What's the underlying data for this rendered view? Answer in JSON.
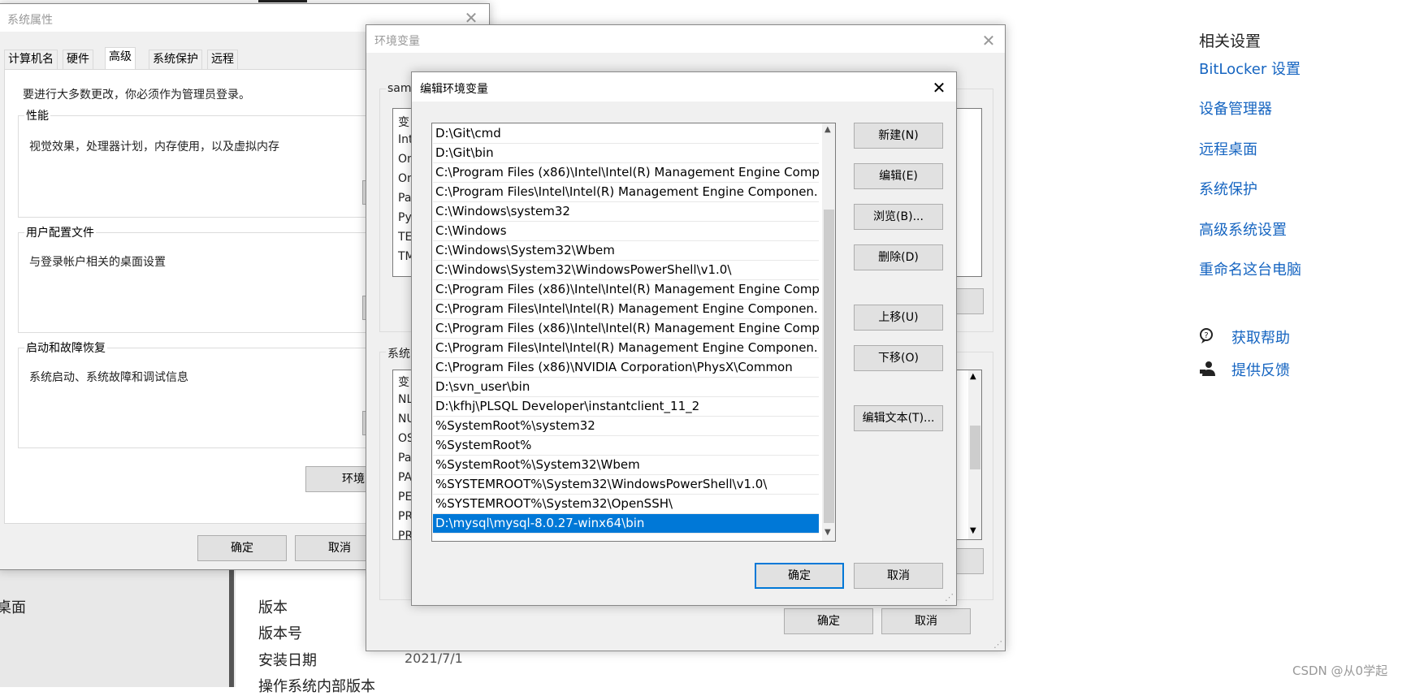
{
  "system_properties": {
    "title": "系统属性",
    "close_glyph": "✕",
    "tabs": [
      "计算机名",
      "硬件",
      "高级",
      "系统保护",
      "远程"
    ],
    "admin_note": "要进行大多数更改，你必须作为管理员登录。",
    "performance": {
      "label": "性能",
      "description": "视觉效果，处理器计划，内存使用，以及虚拟内存"
    },
    "user_profiles": {
      "label": "用户配置文件",
      "description": "与登录帐户相关的桌面设置"
    },
    "startup_recovery": {
      "label": "启动和故障恢复",
      "description": "系统启动、系统故障和调试信息"
    },
    "env_button": "环境",
    "ok_button": "确定",
    "cancel_button": "取消"
  },
  "env_vars": {
    "title": "环境变量",
    "close_glyph": "✕",
    "user_section_label": "sam",
    "user_list_partial": [
      "变",
      "Int",
      "On",
      "On",
      "Pa",
      "Py",
      "TE",
      "TM"
    ],
    "system_section_label": "系统",
    "system_list_partial": [
      "变",
      "NL",
      "NU",
      "OS",
      "Pa",
      "PA",
      "PE",
      "PR",
      "PR"
    ],
    "ok_button": "确定",
    "cancel_button": "取消"
  },
  "edit_env": {
    "title": "编辑环境变量",
    "close_glyph": "✕",
    "path_entries": [
      "D:\\Git\\cmd",
      "D:\\Git\\bin",
      "C:\\Program Files (x86)\\Intel\\Intel(R) Management Engine Comp...",
      "C:\\Program Files\\Intel\\Intel(R) Management Engine Componen...",
      "C:\\Windows\\system32",
      "C:\\Windows",
      "C:\\Windows\\System32\\Wbem",
      "C:\\Windows\\System32\\WindowsPowerShell\\v1.0\\",
      "C:\\Program Files (x86)\\Intel\\Intel(R) Management Engine Comp...",
      "C:\\Program Files\\Intel\\Intel(R) Management Engine Componen...",
      "C:\\Program Files (x86)\\Intel\\Intel(R) Management Engine Comp...",
      "C:\\Program Files\\Intel\\Intel(R) Management Engine Componen...",
      "C:\\Program Files (x86)\\NVIDIA Corporation\\PhysX\\Common",
      "D:\\svn_user\\bin",
      "D:\\kfhj\\PLSQL Developer\\instantclient_11_2",
      "%SystemRoot%\\system32",
      "%SystemRoot%",
      "%SystemRoot%\\System32\\Wbem",
      "%SYSTEMROOT%\\System32\\WindowsPowerShell\\v1.0\\",
      "%SYSTEMROOT%\\System32\\OpenSSH\\",
      "D:\\mysql\\mysql-8.0.27-winx64\\bin"
    ],
    "selected_entry": "D:\\mysql\\mysql-8.0.27-winx64\\bin",
    "new_button": "新建(N)",
    "edit_button": "编辑(E)",
    "browse_button": "浏览(B)...",
    "delete_button": "删除(D)",
    "move_up_button": "上移(U)",
    "move_down_button": "下移(O)",
    "edit_text_button": "编辑文本(T)...",
    "ok_button": "确定",
    "cancel_button": "取消"
  },
  "settings_page": {
    "left_partial": "桌面",
    "about_rows": [
      {
        "label": "版本",
        "value": ""
      },
      {
        "label": "版本号",
        "value": ""
      },
      {
        "label": "安装日期",
        "value": "2021/7/1"
      },
      {
        "label": "操作系统内部版本",
        "value": ""
      }
    ],
    "related_title": "相关设置",
    "related_links": [
      "BitLocker 设置",
      "设备管理器",
      "远程桌面",
      "系统保护",
      "高级系统设置",
      "重命名这台电脑"
    ],
    "help_links": [
      "获取帮助",
      "提供反馈"
    ]
  },
  "watermark": "CSDN @从0学起",
  "colors": {
    "accent": "#0078d7",
    "link": "#1665c1",
    "selection": "#0078d7"
  }
}
